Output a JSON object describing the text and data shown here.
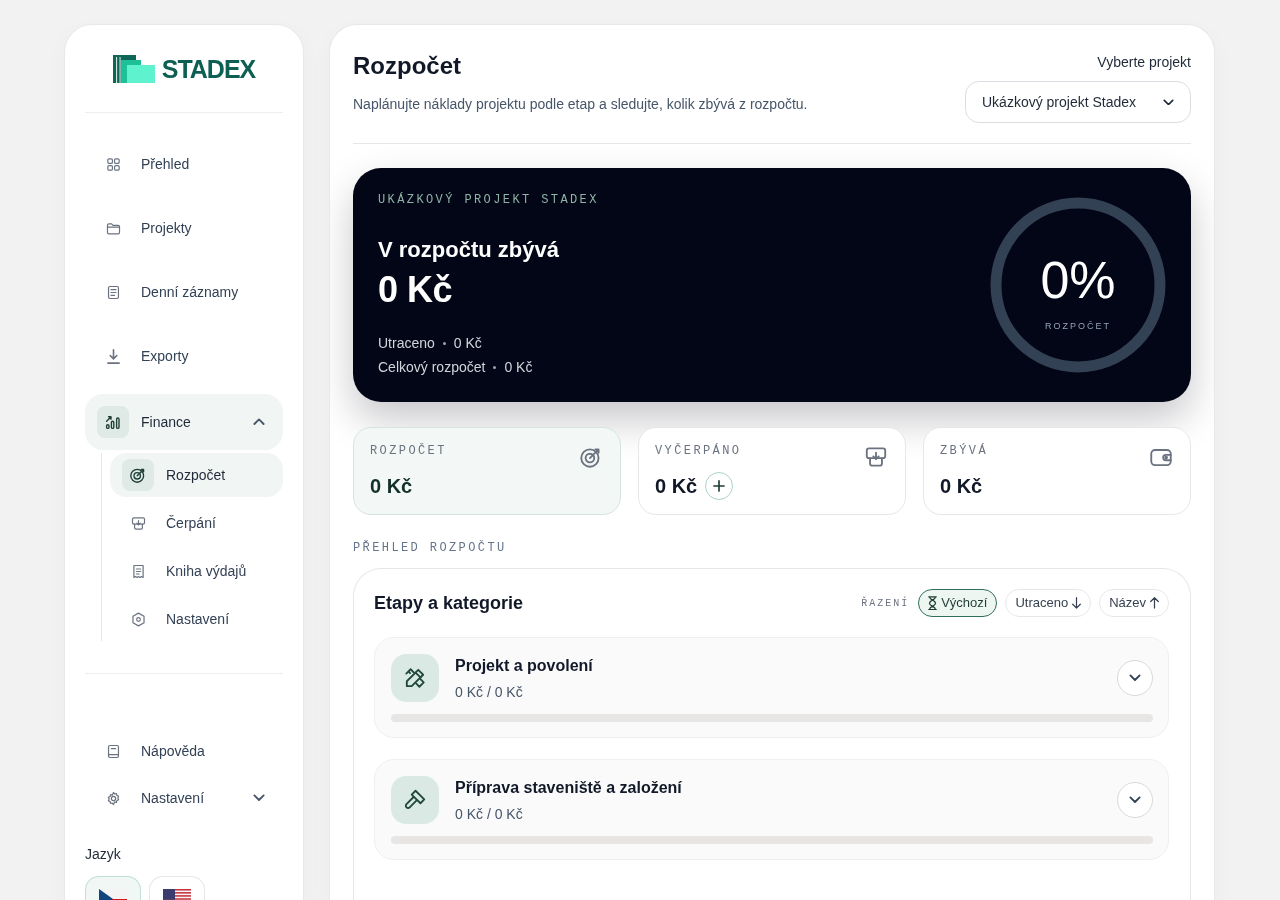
{
  "sidebar": {
    "brand": "STADEX",
    "nav": [
      {
        "label": "Přehled",
        "kind": "link",
        "selected": false
      },
      {
        "label": "Projekty",
        "kind": "link",
        "selected": false
      },
      {
        "label": "Denní záznamy",
        "kind": "link",
        "selected": false
      },
      {
        "label": "Exporty",
        "kind": "link",
        "selected": false
      },
      {
        "label": "Finance",
        "kind": "group",
        "selected": true,
        "expanded": true,
        "children": [
          {
            "label": "Rozpočet",
            "selected": true
          },
          {
            "label": "Čerpání",
            "selected": false
          },
          {
            "label": "Kniha výdajů",
            "selected": false
          },
          {
            "label": "Nastavení",
            "selected": false
          }
        ]
      }
    ],
    "footer": [
      {
        "label": "Nápověda",
        "kind": "link",
        "selected": false
      },
      {
        "label": "Nastavení",
        "kind": "group",
        "selected": false,
        "expanded": false
      }
    ],
    "language": {
      "label": "Jazyk",
      "options": [
        {
          "kind": "cz",
          "selected": true
        },
        {
          "kind": "us",
          "selected": false
        }
      ]
    }
  },
  "header": {
    "title": "Rozpočet",
    "subtitle": "Naplánujte náklady projektu podle etap a sledujte, kolik zbývá z rozpočtu.",
    "project_select": {
      "label": "Vyberte projekt",
      "value": "Ukázkový projekt Stadex"
    }
  },
  "hero": {
    "eyebrow": "UKÁZKOVÝ PROJEKT STADEX",
    "title": "V rozpočtu zbývá",
    "amount": "0 Kč",
    "details": [
      {
        "label": "Utraceno",
        "value": "0 Kč"
      },
      {
        "label": "Celkový rozpočet",
        "value": "0 Kč"
      }
    ],
    "ring": {
      "value": "0%",
      "label": "ROZPOČET"
    }
  },
  "stats": [
    {
      "label": "ROZPOČET",
      "value": "0 Kč",
      "highlighted": true,
      "add_button": false
    },
    {
      "label": "VYČERPÁNO",
      "value": "0 Kč",
      "highlighted": false,
      "add_button": true
    },
    {
      "label": "ZBÝVÁ",
      "value": "0 Kč",
      "highlighted": false,
      "add_button": false
    }
  ],
  "section_label": "PŘEHLED ROZPOČTU",
  "stages_panel": {
    "title": "Etapy a kategorie",
    "sort_label": "ŘAZENÍ",
    "sort_options": [
      {
        "label": "Výchozí",
        "kind": "default",
        "selected": true
      },
      {
        "label": "Utraceno",
        "kind": "descending",
        "selected": false
      },
      {
        "label": "Název",
        "kind": "ascending",
        "selected": false
      }
    ],
    "stages": [
      {
        "name": "Projekt a povolení",
        "amount": "0 Kč / 0 Kč",
        "level": 0,
        "expanded": false
      },
      {
        "name": "Příprava staveniště a založení",
        "amount": "0 Kč / 0 Kč",
        "level": 0,
        "expanded": false
      }
    ]
  }
}
